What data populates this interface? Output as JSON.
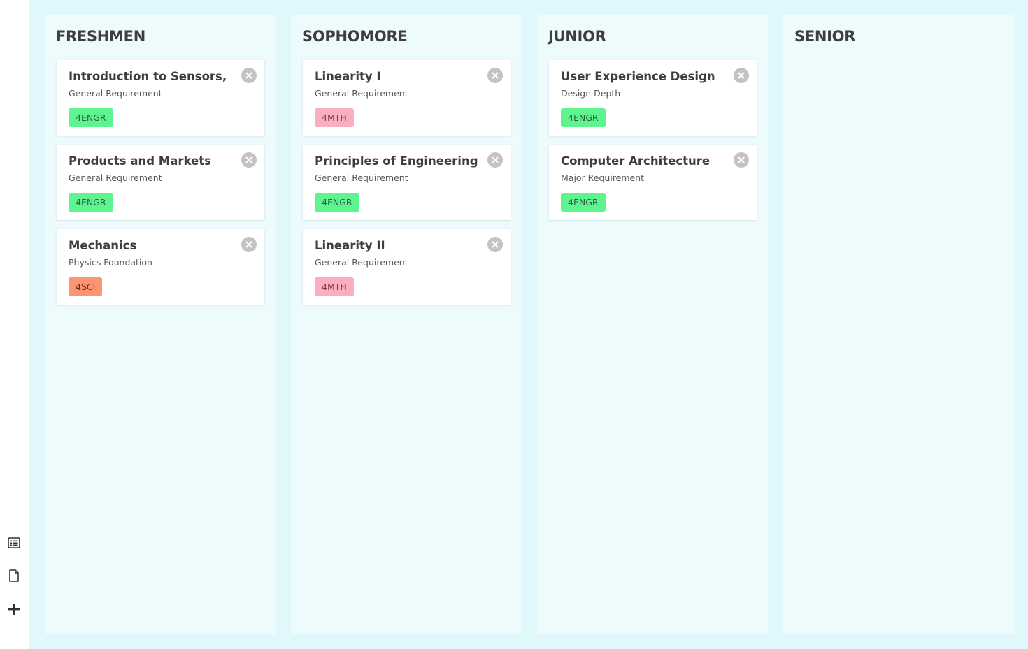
{
  "sidebar": {
    "icons": [
      "list-icon",
      "document-icon",
      "plus-icon"
    ]
  },
  "tag_colors": {
    "4ENGR": "#5ef590",
    "4MTH": "#fbaebf",
    "4SCI": "#fd9670"
  },
  "columns": [
    {
      "title": "FRESHMEN",
      "cards": [
        {
          "title": "Introduction to Sensors,",
          "subtitle": "General Requirement",
          "tag": "4ENGR"
        },
        {
          "title": "Products and Markets",
          "subtitle": "General Requirement",
          "tag": "4ENGR"
        },
        {
          "title": "Mechanics",
          "subtitle": "Physics Foundation",
          "tag": "4SCI"
        }
      ]
    },
    {
      "title": "SOPHOMORE",
      "cards": [
        {
          "title": "Linearity I",
          "subtitle": "General Requirement",
          "tag": "4MTH"
        },
        {
          "title": "Principles of Engineering",
          "subtitle": "General Requirement",
          "tag": "4ENGR"
        },
        {
          "title": "Linearity II",
          "subtitle": "General Requirement",
          "tag": "4MTH"
        }
      ]
    },
    {
      "title": "JUNIOR",
      "cards": [
        {
          "title": "User Experience Design",
          "subtitle": "Design Depth",
          "tag": "4ENGR"
        },
        {
          "title": "Computer Architecture",
          "subtitle": "Major Requirement",
          "tag": "4ENGR"
        }
      ]
    },
    {
      "title": "SENIOR",
      "cards": []
    }
  ]
}
